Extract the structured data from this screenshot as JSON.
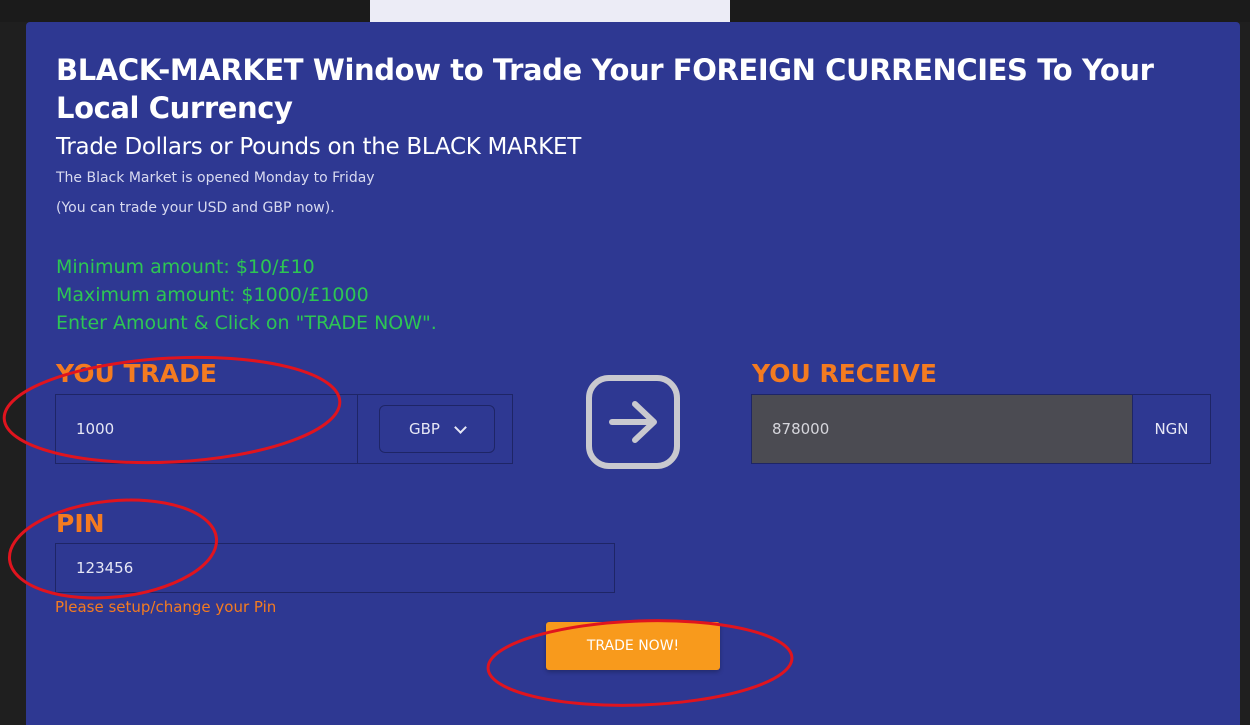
{
  "header": {
    "title": "BLACK-MARKET Window to Trade Your FOREIGN CURRENCIES To Your Local Currency",
    "subtitle": "Trade Dollars or Pounds on the BLACK MARKET",
    "info_line1": "The Black Market is opened Monday to Friday",
    "info_line2": "(You can trade your USD and GBP now)."
  },
  "limits": {
    "minimum": "Minimum amount: $10/£10",
    "maximum": "Maximum amount: $1000/£1000",
    "instruction": "Enter Amount & Click on \"TRADE NOW\"."
  },
  "trade": {
    "label": "YOU TRADE",
    "amount": "1000",
    "currency": "GBP"
  },
  "receive": {
    "label": "YOU RECEIVE",
    "amount": "878000",
    "currency": "NGN"
  },
  "pin": {
    "label": "PIN",
    "value": "123456",
    "setup_link": "Please setup/change your Pin"
  },
  "action": {
    "button_label": "TRADE NOW!"
  },
  "colors": {
    "panel_bg": "#2e3892",
    "orange_label": "#f47b20",
    "green_text": "#2dc653",
    "button_bg": "#f89a1c",
    "annotation_red": "#e0141e"
  },
  "icons": {
    "convert": "arrow-right-icon",
    "select": "chevron-down-icon"
  }
}
